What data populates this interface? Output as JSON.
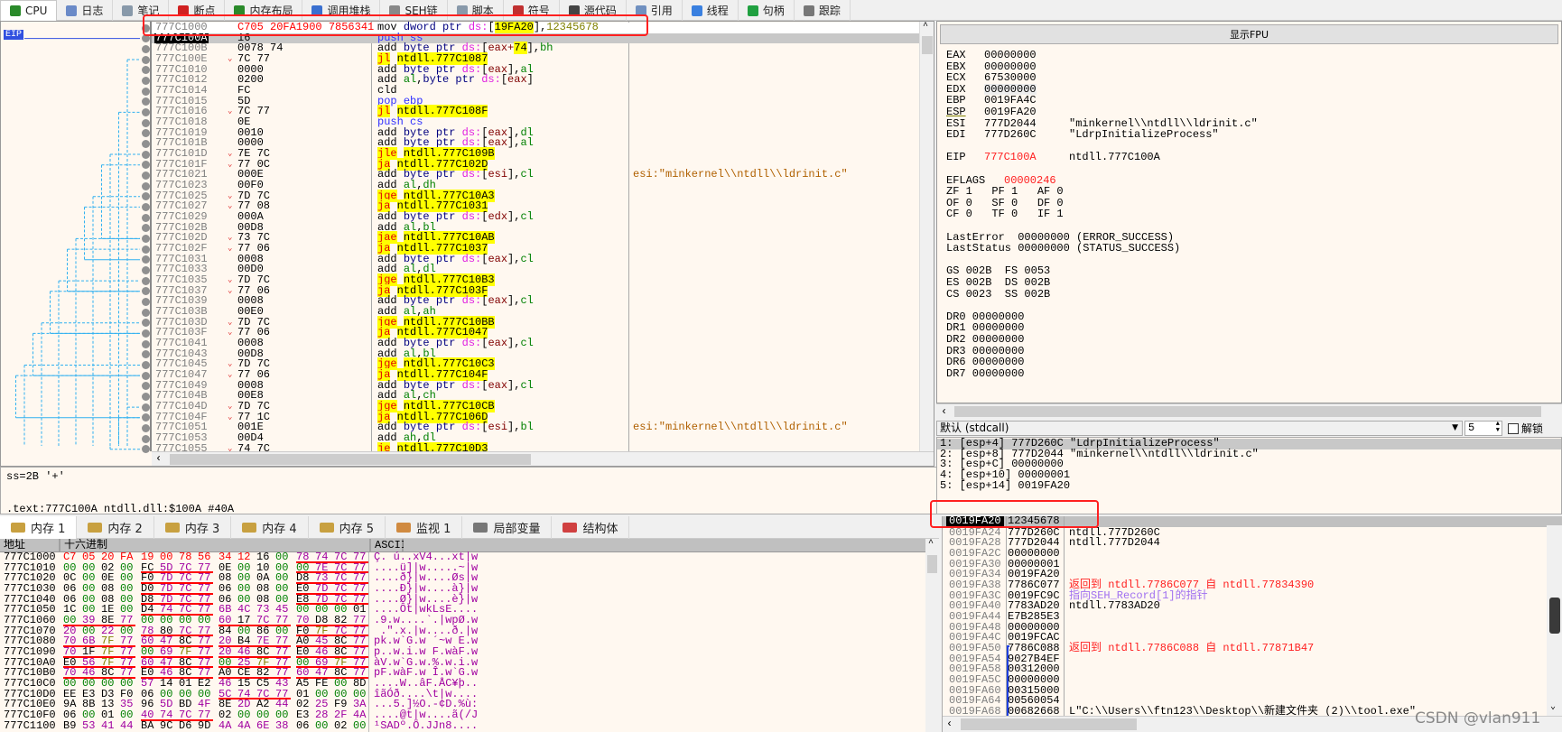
{
  "tabs": [
    {
      "label": "CPU",
      "icon": "cpu-icon",
      "color": "#2a8a2a",
      "active": true
    },
    {
      "label": "日志",
      "icon": "log-icon",
      "color": "#6a8ac8"
    },
    {
      "label": "笔记",
      "icon": "notes-icon",
      "color": "#8899aa"
    },
    {
      "label": "断点",
      "icon": "breakpoint-icon",
      "color": "#d02020"
    },
    {
      "label": "内存布局",
      "icon": "memory-map-icon",
      "color": "#2a8a2a"
    },
    {
      "label": "调用堆栈",
      "icon": "call-stack-icon",
      "color": "#3a70d0"
    },
    {
      "label": "SEH链",
      "icon": "seh-chain-icon",
      "color": "#888888"
    },
    {
      "label": "脚本",
      "icon": "script-icon",
      "color": "#8899aa"
    },
    {
      "label": "符号",
      "icon": "symbols-icon",
      "color": "#c03030"
    },
    {
      "label": "源代码",
      "icon": "source-icon",
      "color": "#444444"
    },
    {
      "label": "引用",
      "icon": "references-icon",
      "color": "#7090c0"
    },
    {
      "label": "线程",
      "icon": "threads-icon",
      "color": "#3a80e0"
    },
    {
      "label": "句柄",
      "icon": "handles-icon",
      "color": "#20a040"
    },
    {
      "label": "跟踪",
      "icon": "trace-icon",
      "color": "#777777"
    }
  ],
  "disasm": {
    "eip_label": "EIP",
    "rows": [
      {
        "addr": "777C1000",
        "bytes": "C705 20FA1900 7856341",
        "ins": "mov dword ptr ds:[19FA20],12345678",
        "modified": true
      },
      {
        "addr": "777C100A",
        "bytes": "16",
        "ins": "push ss",
        "eip": true
      },
      {
        "addr": "777C100B",
        "bytes": "0078 74",
        "ins": "add byte ptr ds:[eax+74],bh"
      },
      {
        "addr": "777C100E",
        "bytes": "7C 77",
        "ins": "jl ntdll.777C1087"
      },
      {
        "addr": "777C1010",
        "bytes": "0000",
        "ins": "add byte ptr ds:[eax],al"
      },
      {
        "addr": "777C1012",
        "bytes": "0200",
        "ins": "add al,byte ptr ds:[eax]"
      },
      {
        "addr": "777C1014",
        "bytes": "FC",
        "ins": "cld"
      },
      {
        "addr": "777C1015",
        "bytes": "5D",
        "ins": "pop ebp"
      },
      {
        "addr": "777C1016",
        "bytes": "7C 77",
        "ins": "jl ntdll.777C108F"
      },
      {
        "addr": "777C1018",
        "bytes": "0E",
        "ins": "push cs"
      },
      {
        "addr": "777C1019",
        "bytes": "0010",
        "ins": "add byte ptr ds:[eax],dl"
      },
      {
        "addr": "777C101B",
        "bytes": "0000",
        "ins": "add byte ptr ds:[eax],al"
      },
      {
        "addr": "777C101D",
        "bytes": "7E 7C",
        "ins": "jle ntdll.777C109B"
      },
      {
        "addr": "777C101F",
        "bytes": "77 0C",
        "ins": "ja ntdll.777C102D"
      },
      {
        "addr": "777C1021",
        "bytes": "000E",
        "ins": "add byte ptr ds:[esi],cl",
        "comment": "esi:\"minkernel\\\\ntdll\\\\ldrinit.c\""
      },
      {
        "addr": "777C1023",
        "bytes": "00F0",
        "ins": "add al,dh"
      },
      {
        "addr": "777C1025",
        "bytes": "7D 7C",
        "ins": "jge ntdll.777C10A3"
      },
      {
        "addr": "777C1027",
        "bytes": "77 08",
        "ins": "ja ntdll.777C1031"
      },
      {
        "addr": "777C1029",
        "bytes": "000A",
        "ins": "add byte ptr ds:[edx],cl"
      },
      {
        "addr": "777C102B",
        "bytes": "00D8",
        "ins": "add al,bl"
      },
      {
        "addr": "777C102D",
        "bytes": "73 7C",
        "ins": "jae ntdll.777C10AB"
      },
      {
        "addr": "777C102F",
        "bytes": "77 06",
        "ins": "ja ntdll.777C1037"
      },
      {
        "addr": "777C1031",
        "bytes": "0008",
        "ins": "add byte ptr ds:[eax],cl"
      },
      {
        "addr": "777C1033",
        "bytes": "00D0",
        "ins": "add al,dl"
      },
      {
        "addr": "777C1035",
        "bytes": "7D 7C",
        "ins": "jge ntdll.777C10B3"
      },
      {
        "addr": "777C1037",
        "bytes": "77 06",
        "ins": "ja ntdll.777C103F"
      },
      {
        "addr": "777C1039",
        "bytes": "0008",
        "ins": "add byte ptr ds:[eax],cl"
      },
      {
        "addr": "777C103B",
        "bytes": "00E0",
        "ins": "add al,ah"
      },
      {
        "addr": "777C103D",
        "bytes": "7D 7C",
        "ins": "jge ntdll.777C10BB"
      },
      {
        "addr": "777C103F",
        "bytes": "77 06",
        "ins": "ja ntdll.777C1047"
      },
      {
        "addr": "777C1041",
        "bytes": "0008",
        "ins": "add byte ptr ds:[eax],cl"
      },
      {
        "addr": "777C1043",
        "bytes": "00D8",
        "ins": "add al,bl"
      },
      {
        "addr": "777C1045",
        "bytes": "7D 7C",
        "ins": "jge ntdll.777C10C3"
      },
      {
        "addr": "777C1047",
        "bytes": "77 06",
        "ins": "ja ntdll.777C104F"
      },
      {
        "addr": "777C1049",
        "bytes": "0008",
        "ins": "add byte ptr ds:[eax],cl"
      },
      {
        "addr": "777C104B",
        "bytes": "00E8",
        "ins": "add al,ch"
      },
      {
        "addr": "777C104D",
        "bytes": "7D 7C",
        "ins": "jge ntdll.777C10CB"
      },
      {
        "addr": "777C104F",
        "bytes": "77 1C",
        "ins": "ja ntdll.777C106D"
      },
      {
        "addr": "777C1051",
        "bytes": "001E",
        "ins": "add byte ptr ds:[esi],bl",
        "comment": "esi:\"minkernel\\\\ntdll\\\\ldrinit.c\""
      },
      {
        "addr": "777C1053",
        "bytes": "00D4",
        "ins": "add ah,dl"
      },
      {
        "addr": "777C1055",
        "bytes": "74 7C",
        "ins": "je ntdll.777C10D3"
      }
    ]
  },
  "info": {
    "line1": "ss=2B '+'",
    "line2": ".text:777C100A ntdll.dll:$100A #40A"
  },
  "registers": {
    "fpu_button": "显示FPU",
    "gpr": [
      {
        "name": "EAX",
        "value": "00000000",
        "comment": ""
      },
      {
        "name": "EBX",
        "value": "00000000",
        "comment": ""
      },
      {
        "name": "ECX",
        "value": "67530000",
        "comment": ""
      },
      {
        "name": "EDX",
        "value": "00000000",
        "comment": ""
      },
      {
        "name": "EBP",
        "value": "0019FA4C",
        "comment": ""
      },
      {
        "name": "ESP",
        "value": "0019FA20",
        "comment": ""
      },
      {
        "name": "ESI",
        "value": "777D2044",
        "comment": "\"minkernel\\\\ntdll\\\\ldrinit.c\""
      },
      {
        "name": "EDI",
        "value": "777D260C",
        "comment": "\"LdrpInitializeProcess\""
      }
    ],
    "eip": {
      "name": "EIP",
      "value": "777C100A",
      "comment": "ntdll.777C100A"
    },
    "eflags": {
      "name": "EFLAGS",
      "value": "00000246"
    },
    "flags": [
      "ZF 1   PF 1   AF 0",
      "OF 0   SF 0   DF 0",
      "CF 0   TF 0   IF 1"
    ],
    "last": [
      "LastError  00000000 (ERROR_SUCCESS)",
      "LastStatus 00000000 (STATUS_SUCCESS)"
    ],
    "segs": [
      "GS 002B  FS 0053",
      "ES 002B  DS 002B",
      "CS 0023  SS 002B"
    ],
    "dr": [
      "DR0 00000000",
      "DR1 00000000",
      "DR2 00000000",
      "DR3 00000000",
      "DR6 00000000",
      "DR7 00000000"
    ]
  },
  "callconv": {
    "selected": "默认 (stdcall)",
    "count": "5",
    "unlock_label": "解锁",
    "unlock_checked": false,
    "args": [
      "1: [esp+4] 777D260C \"LdrpInitializeProcess\"",
      "2: [esp+8] 777D2044 \"minkernel\\\\ntdll\\\\ldrinit.c\"",
      "3: [esp+C] 00000000",
      "4: [esp+10] 00000001",
      "5: [esp+14] 0019FA20"
    ]
  },
  "bottom_tabs": [
    {
      "label": "内存 1",
      "icon": "memory-dump-icon",
      "active": true
    },
    {
      "label": "内存 2",
      "icon": "memory-dump-icon"
    },
    {
      "label": "内存 3",
      "icon": "memory-dump-icon"
    },
    {
      "label": "内存 4",
      "icon": "memory-dump-icon"
    },
    {
      "label": "内存 5",
      "icon": "memory-dump-icon"
    },
    {
      "label": "监视 1",
      "icon": "watch-icon"
    },
    {
      "label": "局部变量",
      "icon": "locals-icon"
    },
    {
      "label": "结构体",
      "icon": "struct-icon"
    }
  ],
  "dump": {
    "headers": {
      "addr": "地址",
      "hex": "十六进制",
      "ascii": "ASCII"
    },
    "modified_bytes": 10,
    "rows": [
      {
        "addr": "777C1000",
        "hex": "C7 05 20 FA 19 00 78 56 34 12 16 00 78 74 7C 77",
        "ascii": "Ç. ú..xV4...xt|w"
      },
      {
        "addr": "777C1010",
        "hex": "00 00 02 00 FC 5D 7C 77 0E 00 10 00 00 7E 7C 77",
        "ascii": "....ü]|w.....~|w"
      },
      {
        "addr": "777C1020",
        "hex": "0C 00 0E 00 F0 7D 7C 77 08 00 0A 00 D8 73 7C 77",
        "ascii": "....ð}|w....Øs|w"
      },
      {
        "addr": "777C1030",
        "hex": "06 00 08 00 D0 7D 7C 77 06 00 08 00 E0 7D 7C 77",
        "ascii": "....Ð}|w....à}|w"
      },
      {
        "addr": "777C1040",
        "hex": "06 00 08 00 D8 7D 7C 77 06 00 08 00 E8 7D 7C 77",
        "ascii": "....Ø}|w....è}|w"
      },
      {
        "addr": "777C1050",
        "hex": "1C 00 1E 00 D4 74 7C 77 6B 4C 73 45 00 00 00 01",
        "ascii": "....Ôt|wkLsE...."
      },
      {
        "addr": "777C1060",
        "hex": "00 39 8E 77 00 00 00 00 60 17 7C 77 70 D8 82 77",
        "ascii": ".9.w....`.|wpØ.w"
      },
      {
        "addr": "777C1070",
        "hex": "20 00 22 00 78 80 7C 77 84 00 86 00 F0 7F 7C 77",
        "ascii": " .\".x.|w....ð.|w"
      },
      {
        "addr": "777C1080",
        "hex": "70 6B 7F 77 60 47 8C 77 20 B4 7E 77 A0 45 8C 77",
        "ascii": "pk.w`G.w ´~w E.w"
      },
      {
        "addr": "777C1090",
        "hex": "70 1F 7F 77 00 69 7F 77 20 46 8C 77 E0 46 8C 77",
        "ascii": "p..w.i.w F.wàF.w"
      },
      {
        "addr": "777C10A0",
        "hex": "E0 56 7F 77 60 47 8C 77 00 25 7F 77 00 69 7F 77",
        "ascii": "àV.w`G.w.%.w.i.w"
      },
      {
        "addr": "777C10B0",
        "hex": "70 46 8C 77 E0 46 8C 77 A0 CE 82 77 60 47 8C 77",
        "ascii": "pF.wàF.w Î.w`G.w"
      },
      {
        "addr": "777C10C0",
        "hex": "00 00 00 00 57 14 01 E2 46 15 C5 43 A5 FE 00 8D",
        "ascii": "....W..âF.ÅC¥þ.."
      },
      {
        "addr": "777C10D0",
        "hex": "EE E3 D3 F0 06 00 00 00 5C 74 7C 77 01 00 00 00",
        "ascii": "îãÓð....\\t|w...."
      },
      {
        "addr": "777C10E0",
        "hex": "9A 8B 13 35 96 5D BD 4F 8E 2D A2 44 02 25 F9 3A",
        "ascii": "...5.]½O.-¢D.%ù:"
      },
      {
        "addr": "777C10F0",
        "hex": "06 00 01 00 40 74 7C 77 02 00 00 00 E3 28 2F 4A",
        "ascii": "....@t|w....ã(/J"
      },
      {
        "addr": "777C1100",
        "hex": "B9 53 41 44 BA 9C D6 9D 4A 4A 6E 38 06 00 02 00",
        "ascii": "¹SADº.Ö.JJn8...."
      }
    ]
  },
  "stack": {
    "rows": [
      {
        "addr": "0019FA20",
        "value": "12345678",
        "comment": "",
        "top": true
      },
      {
        "addr": "0019FA24",
        "value": "777D260C",
        "comment": "ntdll.777D260C"
      },
      {
        "addr": "0019FA28",
        "value": "777D2044",
        "comment": "ntdll.777D2044"
      },
      {
        "addr": "0019FA2C",
        "value": "00000000",
        "comment": ""
      },
      {
        "addr": "0019FA30",
        "value": "00000001",
        "comment": ""
      },
      {
        "addr": "0019FA34",
        "value": "0019FA20",
        "comment": ""
      },
      {
        "addr": "0019FA38",
        "value": "7786C077",
        "comment": "返回到 ntdll.7786C077 自 ntdll.77834390",
        "kind": "return"
      },
      {
        "addr": "0019FA3C",
        "value": "0019FC9C",
        "comment": "指向SEH_Record[1]的指针",
        "kind": "seh"
      },
      {
        "addr": "0019FA40",
        "value": "7783AD20",
        "comment": "ntdll.7783AD20"
      },
      {
        "addr": "0019FA44",
        "value": "E7B285E3",
        "comment": ""
      },
      {
        "addr": "0019FA48",
        "value": "00000000",
        "comment": ""
      },
      {
        "addr": "0019FA4C",
        "value": "0019FCAC",
        "comment": ""
      },
      {
        "addr": "0019FA50",
        "value": "7786C088",
        "comment": "返回到 ntdll.7786C088 自 ntdll.77871B47",
        "kind": "return"
      },
      {
        "addr": "0019FA54",
        "value": "9027B4EF",
        "comment": ""
      },
      {
        "addr": "0019FA58",
        "value": "00312000",
        "comment": ""
      },
      {
        "addr": "0019FA5C",
        "value": "00000000",
        "comment": ""
      },
      {
        "addr": "0019FA60",
        "value": "00315000",
        "comment": ""
      },
      {
        "addr": "0019FA64",
        "value": "00560054",
        "comment": ""
      },
      {
        "addr": "0019FA68",
        "value": "00682668",
        "comment": "L\"C:\\\\Users\\\\ftn123\\\\Desktop\\\\新建文件夹 (2)\\\\tool.exe\""
      }
    ]
  },
  "watermark": "CSDN @vlan911",
  "colors": {
    "panel_bg": "#fff8f0",
    "jump_highlight": "#ffff00",
    "modified": "#ff0000",
    "annotation_box": "#ff2020"
  }
}
